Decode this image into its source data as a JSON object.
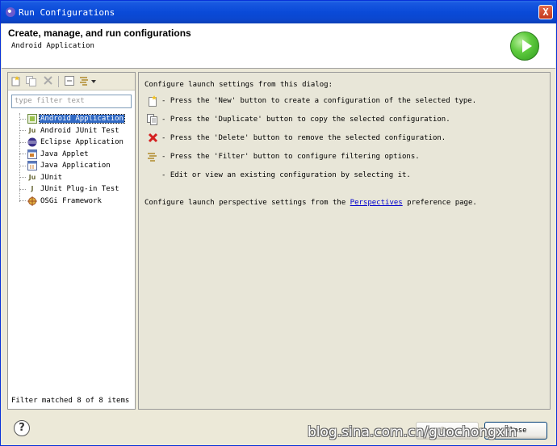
{
  "window": {
    "title": "Run Configurations",
    "close_label": "X"
  },
  "header": {
    "title": "Create, manage, and run configurations",
    "subtitle": "Android Application"
  },
  "filter": {
    "placeholder": "type filter text",
    "status": "Filter matched 8 of 8 items"
  },
  "tree": {
    "items": [
      {
        "label": "Android Application",
        "icon": "android-app-icon",
        "selected": true
      },
      {
        "label": "Android JUnit Test",
        "icon": "junit-icon"
      },
      {
        "label": "Eclipse Application",
        "icon": "eclipse-icon"
      },
      {
        "label": "Java Applet",
        "icon": "applet-icon"
      },
      {
        "label": "Java Application",
        "icon": "java-app-icon"
      },
      {
        "label": "JUnit",
        "icon": "junit-icon"
      },
      {
        "label": "JUnit Plug-in Test",
        "icon": "junit-plugin-icon"
      },
      {
        "label": "OSGi Framework",
        "icon": "osgi-icon"
      }
    ]
  },
  "info": {
    "intro": "Configure launch settings from this dialog:",
    "rows": [
      {
        "text": "- Press the 'New' button to create a configuration of the selected type.",
        "icon": "new-config-icon"
      },
      {
        "text": "- Press the 'Duplicate' button to copy the selected configuration.",
        "icon": "duplicate-icon"
      },
      {
        "text": "- Press the 'Delete' button to remove the selected configuration.",
        "icon": "delete-icon"
      },
      {
        "text": "- Press the 'Filter' button to configure filtering options.",
        "icon": "filter-icon"
      },
      {
        "text": "- Edit or view an existing configuration by selecting it.",
        "icon": ""
      }
    ],
    "footer_before": "Configure launch perspective settings from the ",
    "footer_link": "Perspectives",
    "footer_after": " preference page."
  },
  "buttons": {
    "run": "Run",
    "close": "Close"
  },
  "watermark": "blog.sina.com.cn/guochongxin"
}
